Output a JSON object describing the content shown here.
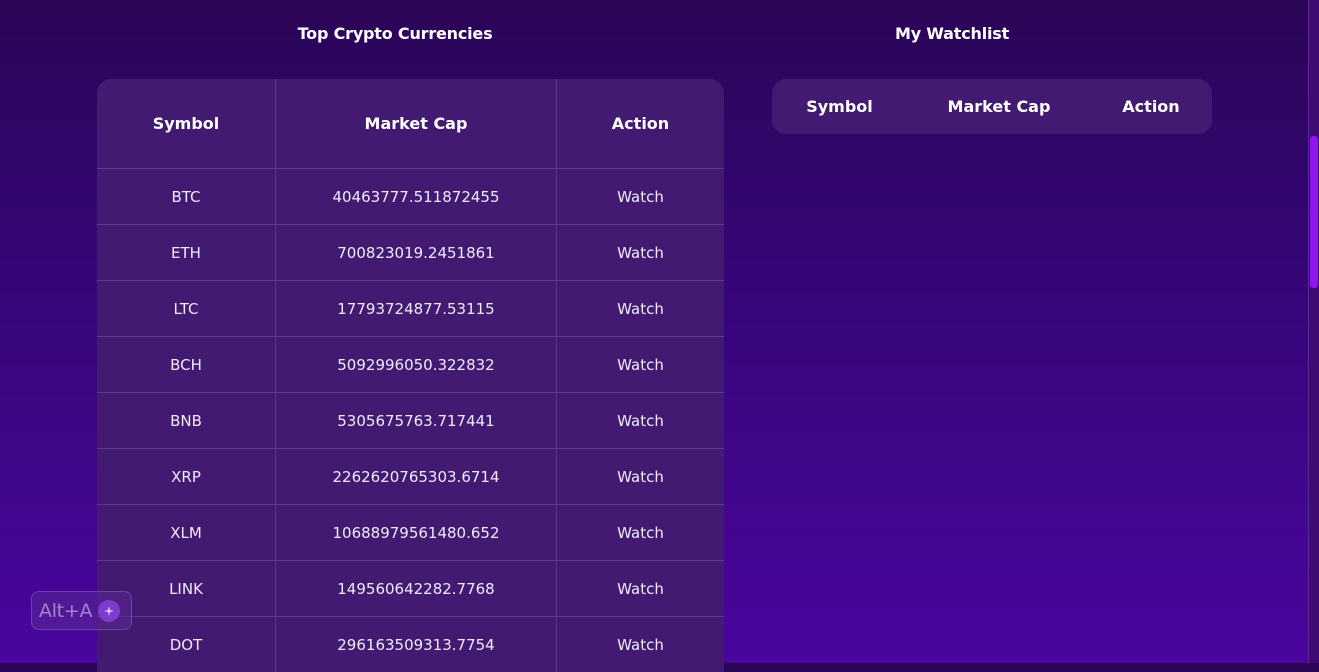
{
  "sections": {
    "left_title": "Top Crypto Currencies",
    "right_title": "My Watchlist"
  },
  "table": {
    "headers": [
      "Symbol",
      "Market Cap",
      "Action"
    ],
    "rows": [
      {
        "symbol": "BTC",
        "market_cap": "40463777.511872455",
        "action": "Watch"
      },
      {
        "symbol": "ETH",
        "market_cap": "700823019.2451861",
        "action": "Watch"
      },
      {
        "symbol": "LTC",
        "market_cap": "17793724877.53115",
        "action": "Watch"
      },
      {
        "symbol": "BCH",
        "market_cap": "5092996050.322832",
        "action": "Watch"
      },
      {
        "symbol": "BNB",
        "market_cap": "5305675763.717441",
        "action": "Watch"
      },
      {
        "symbol": "XRP",
        "market_cap": "2262620765303.6714",
        "action": "Watch"
      },
      {
        "symbol": "XLM",
        "market_cap": "10688979561480.652",
        "action": "Watch"
      },
      {
        "symbol": "LINK",
        "market_cap": "149560642282.7768",
        "action": "Watch"
      },
      {
        "symbol": "DOT",
        "market_cap": "296163509313.7754",
        "action": "Watch"
      }
    ]
  },
  "watchlist": {
    "headers": [
      "Symbol",
      "Market Cap",
      "Action"
    ]
  },
  "overlay": {
    "shortcut_label": "Alt+A",
    "icon": "sparkle-icon"
  },
  "colors": {
    "background_top": "#2b0557",
    "background_bottom": "#4a059e",
    "table_bg": "#431a72",
    "scrollbar_thumb": "#8f14f0"
  }
}
